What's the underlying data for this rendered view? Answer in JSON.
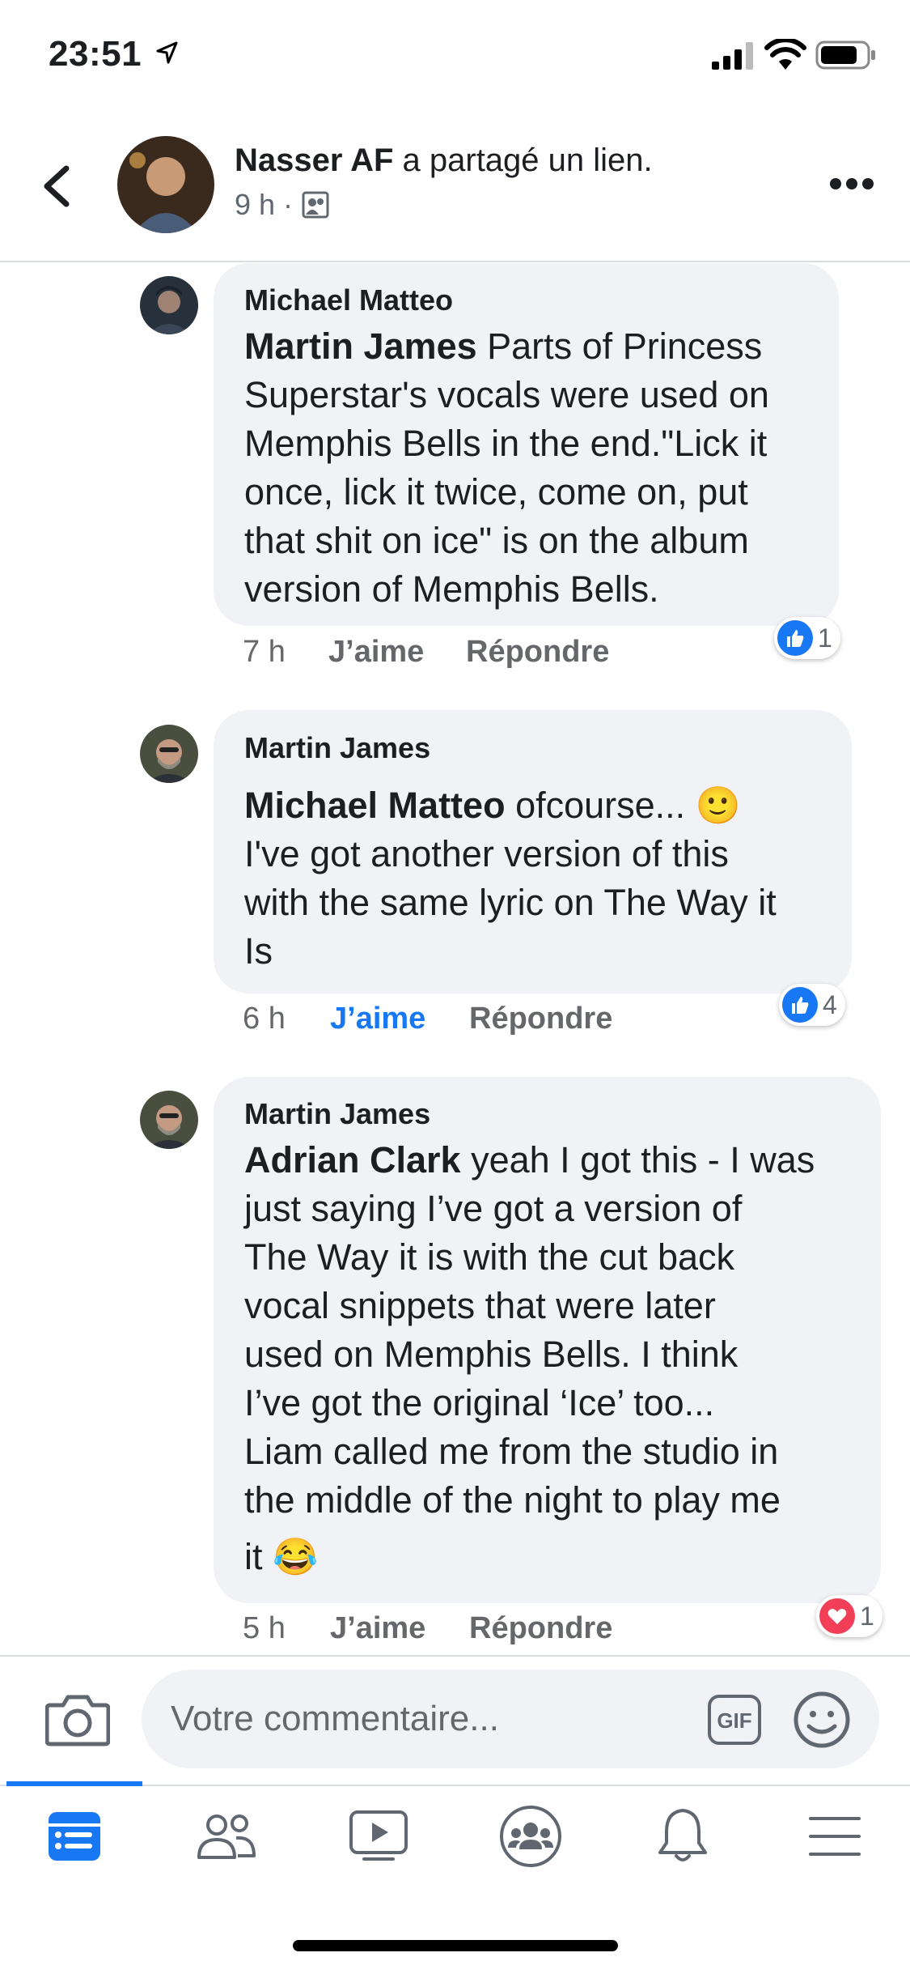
{
  "status_bar": {
    "time": "23:51"
  },
  "header": {
    "poster_name": "Nasser AF",
    "action": "a partagé un lien.",
    "time": "9 h",
    "separator": "·"
  },
  "comments": [
    {
      "author": "Michael Matteo",
      "mention": "Martin James",
      "lines": [
        " Parts of Princess",
        "Superstar's vocals were used on",
        "Memphis Bells in the end.\"Lick it",
        "once, lick it twice, come on, put",
        "that shit on ice\" is on the album",
        "version of Memphis Bells."
      ],
      "time": "7 h",
      "like_label": "J’aime",
      "reply_label": "Répondre",
      "reaction": "like",
      "reaction_count": "1"
    },
    {
      "author": "Martin James",
      "mention": "Michael Matteo",
      "lines": [
        " ofcourse... 🙂",
        "I've got another version of this",
        "with the same lyric on The Way it",
        "Is"
      ],
      "time": "6 h",
      "like_label": "J’aime",
      "reply_label": "Répondre",
      "liked": true,
      "reaction": "like",
      "reaction_count": "4"
    },
    {
      "author": "Martin James",
      "mention": "Adrian Clark",
      "lines": [
        " yeah I got this - I was",
        "just saying I’ve got a version of",
        "The Way it is with the cut back",
        "vocal snippets that were later",
        "used on Memphis  Bells. I think",
        "I’ve got the original ‘Ice’ too...",
        "Liam called me from the studio in",
        "the middle of the night to play me",
        "it 😂"
      ],
      "time": "5 h",
      "like_label": "J’aime",
      "reply_label": "Répondre",
      "reaction": "love",
      "reaction_count": "1"
    }
  ],
  "composer": {
    "placeholder": "Votre commentaire...",
    "gif_label": "GIF"
  },
  "tabs": [
    "home-icon",
    "friends-icon",
    "watch-icon",
    "groups-icon",
    "notifications-icon",
    "menu-icon"
  ],
  "colors": {
    "accent": "#1877f2",
    "bubble": "#f0f2f5",
    "love": "#f33e58"
  }
}
